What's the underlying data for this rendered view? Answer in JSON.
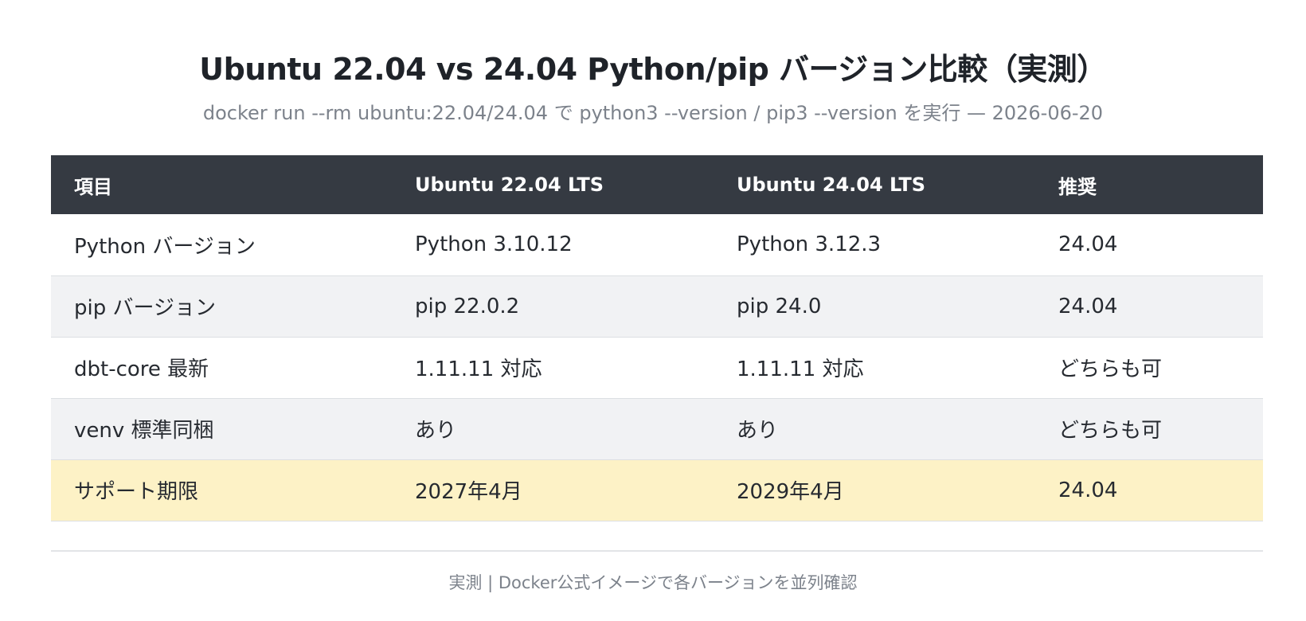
{
  "header": {
    "title": "Ubuntu 22.04 vs 24.04 Python/pip バージョン比較（実測）",
    "subtitle": "docker run --rm ubuntu:22.04/24.04 で python3 --version / pip3 --version を実行 — 2026-06-20"
  },
  "table": {
    "columns": [
      "項目",
      "Ubuntu 22.04 LTS",
      "Ubuntu 24.04 LTS",
      "推奨"
    ],
    "rows": [
      [
        "Python バージョン",
        "Python 3.10.12",
        "Python 3.12.3",
        "24.04"
      ],
      [
        "pip バージョン",
        "pip 22.0.2",
        "pip 24.0",
        "24.04"
      ],
      [
        "dbt-core 最新",
        "1.11.11 対応",
        "1.11.11 対応",
        "どちらも可"
      ],
      [
        "venv 標準同梱",
        "あり",
        "あり",
        "どちらも可"
      ],
      [
        "サポート期限",
        "2027年4月",
        "2029年4月",
        "24.04"
      ]
    ],
    "highlight_row_color": "#fdf2c6",
    "header_color": "#353a42"
  },
  "footer": {
    "note": "実測 | Docker公式イメージで各バージョンを並列確認"
  }
}
